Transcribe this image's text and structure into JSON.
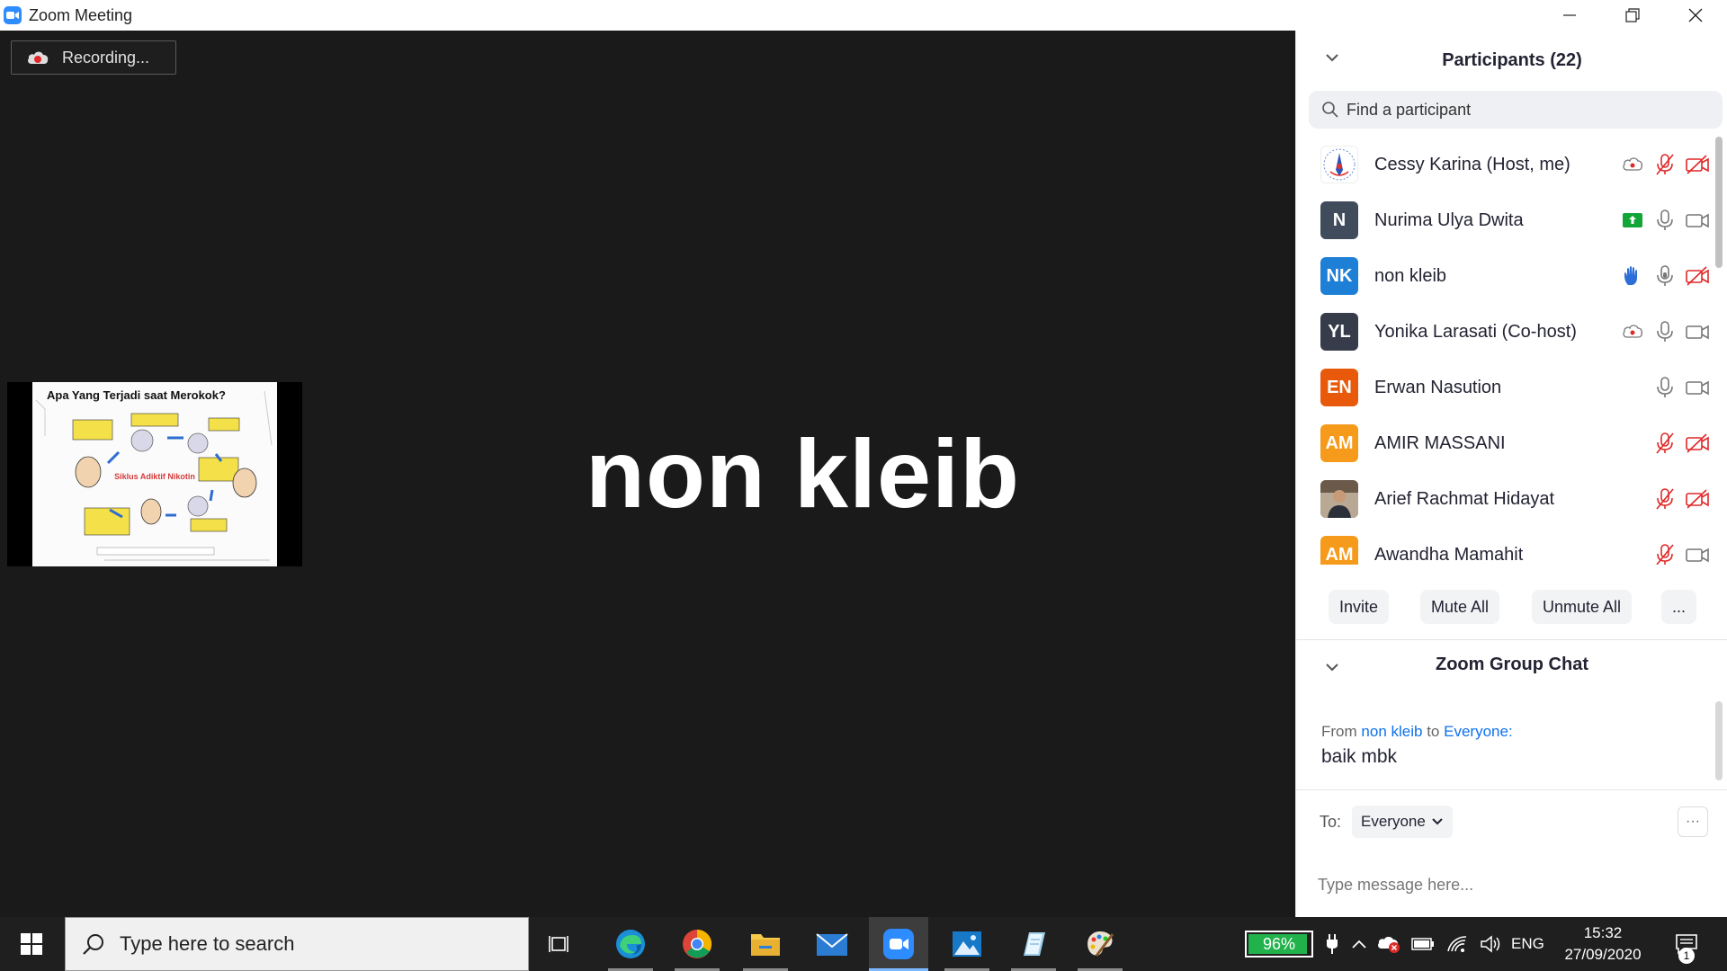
{
  "window": {
    "title": "Zoom Meeting"
  },
  "stage": {
    "recording_label": "Recording...",
    "active_speaker": "non kleib",
    "shared_slide_title": "Apa Yang Terjadi saat Merokok?",
    "shared_slide_center": "Siklus Adiktif Nikotin"
  },
  "participants": {
    "title": "Participants (22)",
    "search_placeholder": "Find a participant",
    "list": [
      {
        "name": "Cessy Karina (Host, me)",
        "initials": "",
        "color": "#ffffff",
        "status": [
          "cloud-record-icon",
          "mic-muted-icon",
          "video-off-icon"
        ]
      },
      {
        "name": "Nurima Ulya Dwita",
        "initials": "N",
        "color": "#404c5c",
        "status": [
          "share-screen-icon",
          "mic-icon",
          "video-icon"
        ]
      },
      {
        "name": "non kleib",
        "initials": "NK",
        "color": "#1e7fd6",
        "status": [
          "raise-hand-icon",
          "mic-icon",
          "video-off-icon"
        ]
      },
      {
        "name": "Yonika Larasati (Co-host)",
        "initials": "YL",
        "color": "#363c4a",
        "status": [
          "cloud-record-icon",
          "mic-icon",
          "video-icon"
        ]
      },
      {
        "name": "Erwan Nasution",
        "initials": "EN",
        "color": "#e8590c",
        "status": [
          "mic-icon",
          "video-icon"
        ]
      },
      {
        "name": "AMIR MASSANI",
        "initials": "AM",
        "color": "#f59a1b",
        "status": [
          "mic-muted-icon",
          "video-off-icon"
        ]
      },
      {
        "name": "Arief Rachmat Hidayat",
        "initials": "",
        "color": "#8a7a6a",
        "status": [
          "mic-muted-icon",
          "video-off-icon"
        ]
      },
      {
        "name": "Awandha Mamahit",
        "initials": "AM",
        "color": "#f59a1b",
        "status": [
          "mic-muted-icon",
          "video-icon"
        ]
      }
    ],
    "actions": {
      "invite": "Invite",
      "mute_all": "Mute All",
      "unmute_all": "Unmute All",
      "more": "..."
    }
  },
  "chat": {
    "title": "Zoom Group Chat",
    "message": {
      "from_prefix": "From",
      "sender": "non kleib",
      "to_word": "to",
      "recipient": "Everyone:",
      "text": "baik mbk"
    },
    "to_label": "To:",
    "to_value": "Everyone",
    "input_placeholder": "Type message here...",
    "more": "···"
  },
  "taskbar": {
    "search_placeholder": "Type here to search",
    "battery": "96%",
    "battery_level": 0.96,
    "language": "ENG",
    "time": "15:32",
    "date": "27/09/2020",
    "notification_count": "1"
  },
  "colors": {
    "zoom_blue": "#2d8cff",
    "muted_red": "#e02828",
    "taskbar": "#1f1f1f",
    "battery_green": "#22b24c"
  }
}
